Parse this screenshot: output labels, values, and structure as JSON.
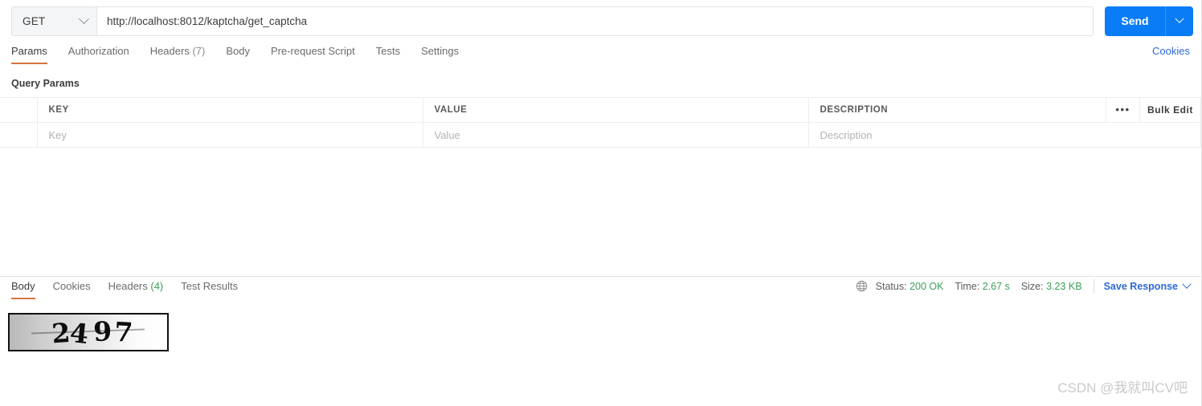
{
  "request": {
    "method": "GET",
    "method_icon": "chevron-down-icon",
    "url_value": "http://localhost:8012/kaptcha/get_captcha",
    "url_placeholder": "Enter request URL",
    "send_label": "Send",
    "send_caret_icon": "chevron-down-icon",
    "tabs": [
      {
        "label": "Params",
        "count": "",
        "active": true
      },
      {
        "label": "Authorization",
        "count": "",
        "active": false
      },
      {
        "label": "Headers",
        "count": "(7)",
        "active": false
      },
      {
        "label": "Body",
        "count": "",
        "active": false
      },
      {
        "label": "Pre-request Script",
        "count": "",
        "active": false
      },
      {
        "label": "Tests",
        "count": "",
        "active": false
      },
      {
        "label": "Settings",
        "count": "",
        "active": false
      }
    ],
    "cookies_link": "Cookies",
    "query_params_title": "Query Params"
  },
  "params_table": {
    "headers": [
      "KEY",
      "VALUE",
      "DESCRIPTION"
    ],
    "dots_label": "•••",
    "bulk_edit_label": "Bulk Edit",
    "rows": [
      {
        "key_placeholder": "Key",
        "value_placeholder": "Value",
        "description_placeholder": "Description"
      }
    ]
  },
  "response": {
    "tabs": [
      {
        "label": "Body",
        "count": "",
        "active": true
      },
      {
        "label": "Cookies",
        "count": "",
        "active": false
      },
      {
        "label": "Headers",
        "count": "(4)",
        "active": false
      },
      {
        "label": "Test Results",
        "count": "",
        "active": false
      }
    ],
    "globe_icon": "globe-icon",
    "status_label": "Status:",
    "status_value": "200 OK",
    "time_label": "Time:",
    "time_value": "2.67 s",
    "size_label": "Size:",
    "size_value": "3.23 KB",
    "save_response_label": "Save Response",
    "save_response_icon": "chevron-down-icon",
    "body_image": {
      "type": "captcha-image",
      "digits": [
        "2",
        "4",
        "9",
        "7"
      ],
      "text": "2497"
    }
  },
  "watermark": "CSDN @我就叫CV吧",
  "colors": {
    "accent_blue": "#0a7cf6",
    "link_blue": "#2d6ad6",
    "tab_underline": "#d2753f",
    "status_green": "#3c9e58",
    "border": "#e4e4e4"
  }
}
